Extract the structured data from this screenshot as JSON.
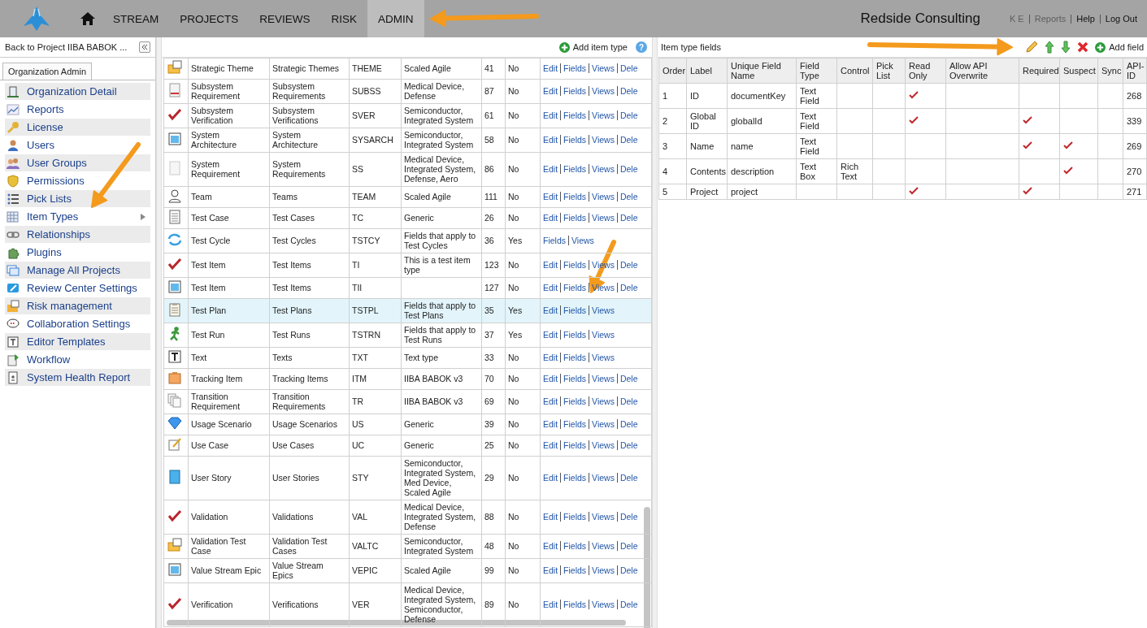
{
  "nav": {
    "tabs": [
      {
        "label": "STREAM",
        "selected": false
      },
      {
        "label": "PROJECTS",
        "selected": false
      },
      {
        "label": "REVIEWS",
        "selected": false
      },
      {
        "label": "RISK",
        "selected": false
      },
      {
        "label": "ADMIN",
        "selected": true
      }
    ],
    "org": "Redside Consulting",
    "links": [
      {
        "label": "K E",
        "muted": true
      },
      {
        "label": "Reports",
        "muted": true
      },
      {
        "label": "Help",
        "muted": false
      },
      {
        "label": "Log Out",
        "muted": false
      }
    ]
  },
  "sidebar": {
    "back": "Back to Project IIBA BABOK ...",
    "tab": "Organization Admin",
    "items": [
      {
        "label": "Organization Detail",
        "kind": "building",
        "submenu": false
      },
      {
        "label": "Reports",
        "kind": "chart",
        "submenu": false
      },
      {
        "label": "License",
        "kind": "key",
        "submenu": false
      },
      {
        "label": "Users",
        "kind": "user",
        "submenu": false
      },
      {
        "label": "User Groups",
        "kind": "users",
        "submenu": false
      },
      {
        "label": "Permissions",
        "kind": "shield",
        "submenu": false
      },
      {
        "label": "Pick Lists",
        "kind": "list",
        "submenu": false
      },
      {
        "label": "Item Types",
        "kind": "grid",
        "submenu": true
      },
      {
        "label": "Relationships",
        "kind": "link",
        "submenu": false
      },
      {
        "label": "Plugins",
        "kind": "puzzle",
        "submenu": false
      },
      {
        "label": "Manage All Projects",
        "kind": "windows",
        "submenu": false
      },
      {
        "label": "Review Center Settings",
        "kind": "pen",
        "submenu": false
      },
      {
        "label": "Risk management",
        "kind": "folder",
        "submenu": false
      },
      {
        "label": "Collaboration Settings",
        "kind": "chat",
        "submenu": false
      },
      {
        "label": "Editor Templates",
        "kind": "text",
        "submenu": false
      },
      {
        "label": "Workflow",
        "kind": "flow",
        "submenu": false
      },
      {
        "label": "System Health Report",
        "kind": "report",
        "submenu": false
      }
    ]
  },
  "item_types": {
    "add": "Add item type",
    "help": "?",
    "rows": [
      {
        "kind": "folder",
        "name": "Strategic Theme",
        "plural": "Strategic Themes",
        "key": "THEME",
        "description": "Scaled Agile",
        "count": "41",
        "system": "No",
        "selected": false,
        "actions": [
          "Edit",
          "Fields",
          "Views",
          "Dele"
        ]
      },
      {
        "kind": "document",
        "name": "Subsystem Requirement",
        "plural": "Subsystem Requirements",
        "key": "SUBSS",
        "description": "Medical Device, Defense",
        "count": "87",
        "system": "No",
        "selected": false,
        "actions": [
          "Edit",
          "Fields",
          "Views",
          "Dele"
        ]
      },
      {
        "kind": "check",
        "name": "Subsystem Verification",
        "plural": "Subsystem Verifications",
        "key": "SVER",
        "description": "Semiconductor, Integrated System",
        "count": "61",
        "system": "No",
        "selected": false,
        "actions": [
          "Edit",
          "Fields",
          "Views",
          "Dele"
        ]
      },
      {
        "kind": "window",
        "name": "System Architecture",
        "plural": "System Architecture",
        "key": "SYSARCH",
        "description": "Semiconductor, Integrated System",
        "count": "58",
        "system": "No",
        "selected": false,
        "actions": [
          "Edit",
          "Fields",
          "Views",
          "Dele"
        ]
      },
      {
        "kind": "page",
        "name": "System Requirement",
        "plural": "System Requirements",
        "key": "SS",
        "description": "Medical Device, Integrated System, Defense, Aero",
        "count": "86",
        "system": "No",
        "selected": false,
        "actions": [
          "Edit",
          "Fields",
          "Views",
          "Dele"
        ]
      },
      {
        "kind": "person",
        "name": "Team",
        "plural": "Teams",
        "key": "TEAM",
        "description": "Scaled Agile",
        "count": "111",
        "system": "No",
        "selected": false,
        "actions": [
          "Edit",
          "Fields",
          "Views",
          "Dele"
        ]
      },
      {
        "kind": "list",
        "name": "Test Case",
        "plural": "Test Cases",
        "key": "TC",
        "description": "Generic",
        "count": "26",
        "system": "No",
        "selected": false,
        "actions": [
          "Edit",
          "Fields",
          "Views",
          "Dele"
        ]
      },
      {
        "kind": "cycle",
        "name": "Test Cycle",
        "plural": "Test Cycles",
        "key": "TSTCY",
        "description": "Fields that apply to Test Cycles",
        "count": "36",
        "system": "Yes",
        "selected": false,
        "actions": [
          "Fields",
          "Views"
        ]
      },
      {
        "kind": "check",
        "name": "Test Item",
        "plural": "Test Items",
        "key": "TI",
        "description": "This is a test item type",
        "count": "123",
        "system": "No",
        "selected": false,
        "actions": [
          "Edit",
          "Fields",
          "Views",
          "Dele"
        ]
      },
      {
        "kind": "window",
        "name": "Test Item",
        "plural": "Test Items",
        "key": "TII",
        "description": "",
        "count": "127",
        "system": "No",
        "selected": false,
        "actions": [
          "Edit",
          "Fields",
          "Views",
          "Dele"
        ]
      },
      {
        "kind": "clipboard",
        "name": "Test Plan",
        "plural": "Test Plans",
        "key": "TSTPL",
        "description": "Fields that apply to Test Plans",
        "count": "35",
        "system": "Yes",
        "selected": true,
        "actions": [
          "Edit",
          "Fields",
          "Views"
        ]
      },
      {
        "kind": "runner",
        "name": "Test Run",
        "plural": "Test Runs",
        "key": "TSTRN",
        "description": "Fields that apply to Test Runs",
        "count": "37",
        "system": "Yes",
        "selected": false,
        "actions": [
          "Edit",
          "Fields",
          "Views"
        ]
      },
      {
        "kind": "text",
        "name": "Text",
        "plural": "Texts",
        "key": "TXT",
        "description": "Text type",
        "count": "33",
        "system": "No",
        "selected": false,
        "actions": [
          "Edit",
          "Fields",
          "Views"
        ]
      },
      {
        "kind": "box",
        "name": "Tracking Item",
        "plural": "Tracking Items",
        "key": "ITM",
        "description": "IIBA BABOK v3",
        "count": "70",
        "system": "No",
        "selected": false,
        "actions": [
          "Edit",
          "Fields",
          "Views",
          "Dele"
        ]
      },
      {
        "kind": "copies",
        "name": "Transition Requirement",
        "plural": "Transition Requirements",
        "key": "TR",
        "description": "IIBA BABOK v3",
        "count": "69",
        "system": "No",
        "selected": false,
        "actions": [
          "Edit",
          "Fields",
          "Views",
          "Dele"
        ]
      },
      {
        "kind": "gem",
        "name": "Usage Scenario",
        "plural": "Usage Scenarios",
        "key": "US",
        "description": "Generic",
        "count": "39",
        "system": "No",
        "selected": false,
        "actions": [
          "Edit",
          "Fields",
          "Views",
          "Dele"
        ]
      },
      {
        "kind": "note",
        "name": "Use Case",
        "plural": "Use Cases",
        "key": "UC",
        "description": "Generic",
        "count": "25",
        "system": "No",
        "selected": false,
        "actions": [
          "Edit",
          "Fields",
          "Views",
          "Dele"
        ]
      },
      {
        "kind": "book",
        "name": "User Story",
        "plural": "User Stories",
        "key": "STY",
        "description": "Semiconductor, Integrated System, Med Device, Scaled Agile",
        "count": "29",
        "system": "No",
        "selected": false,
        "actions": [
          "Edit",
          "Fields",
          "Views",
          "Dele"
        ]
      },
      {
        "kind": "check",
        "name": "Validation",
        "plural": "Validations",
        "key": "VAL",
        "description": "Medical Device, Integrated System, Defense",
        "count": "88",
        "system": "No",
        "selected": false,
        "actions": [
          "Edit",
          "Fields",
          "Views",
          "Dele"
        ]
      },
      {
        "kind": "folder",
        "name": "Validation Test Case",
        "plural": "Validation Test Cases",
        "key": "VALTC",
        "description": "Semiconductor, Integrated System",
        "count": "48",
        "system": "No",
        "selected": false,
        "actions": [
          "Edit",
          "Fields",
          "Views",
          "Dele"
        ]
      },
      {
        "kind": "window",
        "name": "Value Stream Epic",
        "plural": "Value Stream Epics",
        "key": "VEPIC",
        "description": "Scaled Agile",
        "count": "99",
        "system": "No",
        "selected": false,
        "actions": [
          "Edit",
          "Fields",
          "Views",
          "Dele"
        ]
      },
      {
        "kind": "check",
        "name": "Verification",
        "plural": "Verifications",
        "key": "VER",
        "description": "Medical Device, Integrated System, Semiconductor, Defense",
        "count": "89",
        "system": "No",
        "selected": false,
        "actions": [
          "Edit",
          "Fields",
          "Views",
          "Dele"
        ]
      }
    ]
  },
  "fields": {
    "title": "Item type fields",
    "add": "Add field",
    "columns": [
      "Order",
      "Label",
      "Unique Field Name",
      "Field Type",
      "Control",
      "Pick List",
      "Read Only",
      "Allow API Overwrite",
      "Required",
      "Suspect",
      "Sync",
      "API-ID"
    ],
    "rows": [
      {
        "order": "1",
        "label": "ID",
        "unique": "documentKey",
        "type": "Text Field",
        "control": "",
        "read_only": true,
        "allow_api": false,
        "required": false,
        "suspect": false,
        "sync": false,
        "api_id": "268"
      },
      {
        "order": "2",
        "label": "Global ID",
        "unique": "globalId",
        "type": "Text Field",
        "control": "",
        "read_only": true,
        "allow_api": false,
        "required": true,
        "suspect": false,
        "sync": false,
        "api_id": "339"
      },
      {
        "order": "3",
        "label": "Name",
        "unique": "name",
        "type": "Text Field",
        "control": "",
        "read_only": false,
        "allow_api": false,
        "required": true,
        "suspect": true,
        "sync": false,
        "api_id": "269"
      },
      {
        "order": "4",
        "label": "Contents",
        "unique": "description",
        "type": "Text Box",
        "control": "Rich Text",
        "read_only": false,
        "allow_api": false,
        "required": false,
        "suspect": true,
        "sync": false,
        "api_id": "270"
      },
      {
        "order": "5",
        "label": "Project",
        "unique": "project",
        "type": "",
        "control": "",
        "read_only": true,
        "allow_api": false,
        "required": true,
        "suspect": false,
        "sync": false,
        "api_id": "271"
      }
    ]
  }
}
